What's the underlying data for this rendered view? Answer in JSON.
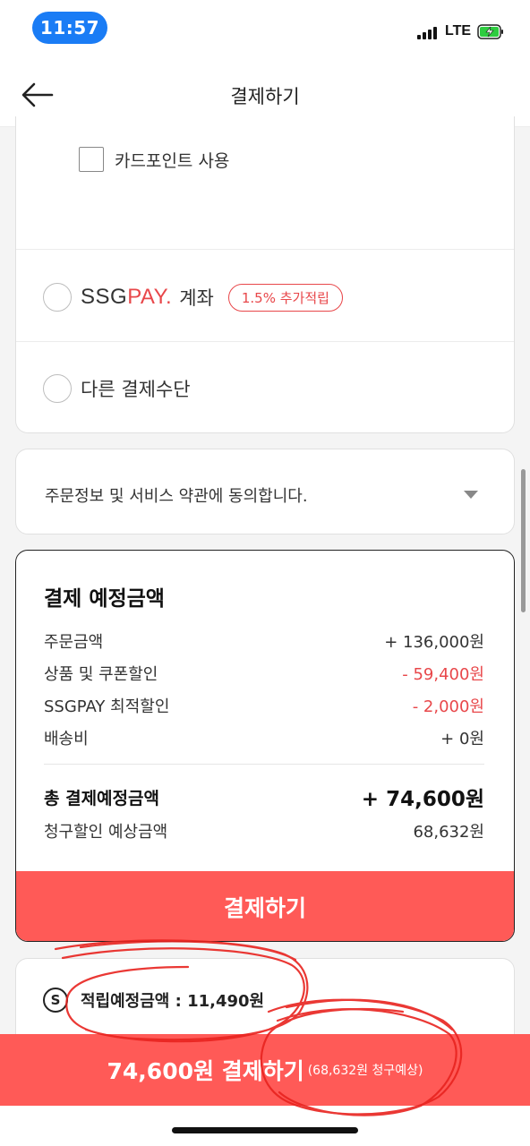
{
  "status": {
    "time": "11:57",
    "network": "LTE"
  },
  "header": {
    "title": "결제하기"
  },
  "payment_methods": {
    "card_point_label": "카드포인트 사용",
    "ssgpay": {
      "logo_ssg": "SSG",
      "logo_pay": "PAY.",
      "account": "계좌",
      "badge": "1.5% 추가적립"
    },
    "other_label": "다른 결제수단"
  },
  "terms": {
    "text": "주문정보 및 서비스 약관에 동의합니다."
  },
  "summary": {
    "title": "결제 예정금액",
    "lines": [
      {
        "label": "주문금액",
        "value": "+ 136,000원"
      },
      {
        "label": "상품 및 쿠폰할인",
        "value": "- 59,400원"
      },
      {
        "label": "SSGPAY 최적할인",
        "value": "- 2,000원"
      },
      {
        "label": "배송비",
        "value": "+ 0원"
      }
    ],
    "total_label": "총 결제예정금액",
    "total_value": "+ 74,600원",
    "billing_label": "청구할인 예상금액",
    "billing_value": "68,632원",
    "pay_button": "결제하기"
  },
  "points": {
    "icon": "S",
    "text": "적립예정금액 : 11,490원"
  },
  "bottom_bar": {
    "main": "74,600원 결제하기",
    "sub": "(68,632원 청구예상)"
  },
  "colors": {
    "accent": "#ff5a57",
    "discount_red": "#e8474a",
    "time_pill": "#1a7cf5",
    "annotation": "#e8231f"
  }
}
